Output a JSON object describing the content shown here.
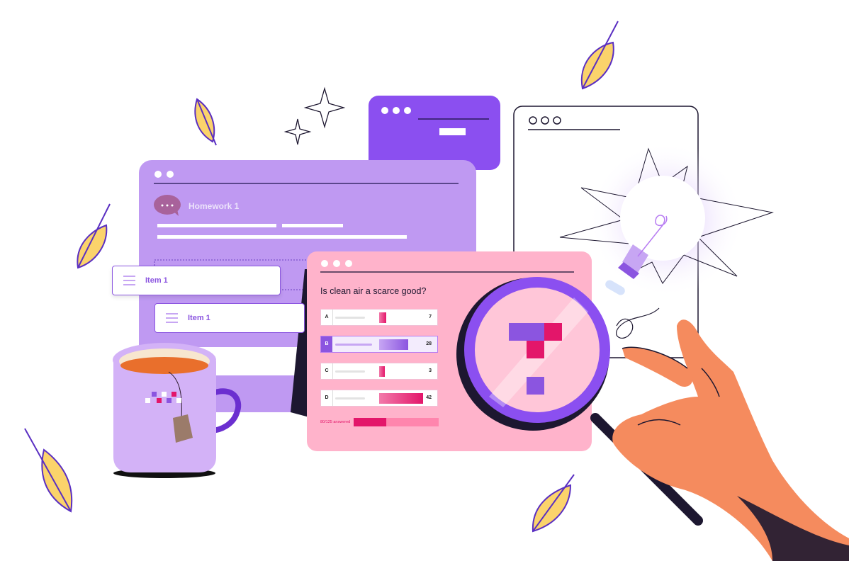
{
  "colors": {
    "purple": "#8b55e0",
    "lavender": "#bf99f2",
    "pink": "#ffb3cb",
    "magenta": "#e3166a",
    "orange": "#f58b5e",
    "leaf": "#fbd36b"
  },
  "homework_window": {
    "title": "Homework 1",
    "icon": "chat-bubble-icon",
    "items": [
      {
        "label": "Item 1"
      },
      {
        "label": "Item 1"
      }
    ]
  },
  "poll_window": {
    "question": "Is clean air a scarce good?",
    "options": [
      {
        "letter": "A",
        "count": "7",
        "value": 7,
        "selected": false
      },
      {
        "letter": "B",
        "count": "28",
        "value": 28,
        "selected": true
      },
      {
        "letter": "C",
        "count": "3",
        "value": 3,
        "selected": false
      },
      {
        "letter": "D",
        "count": "42",
        "value": 42,
        "selected": false
      }
    ],
    "answered_text": "80/125 answered",
    "answered_fraction": 0.64
  },
  "icons": [
    "magnifying-glass-icon",
    "light-bulb-icon",
    "coffee-mug-icon",
    "leaf-icon",
    "sparkle-icon",
    "hand-icon"
  ]
}
